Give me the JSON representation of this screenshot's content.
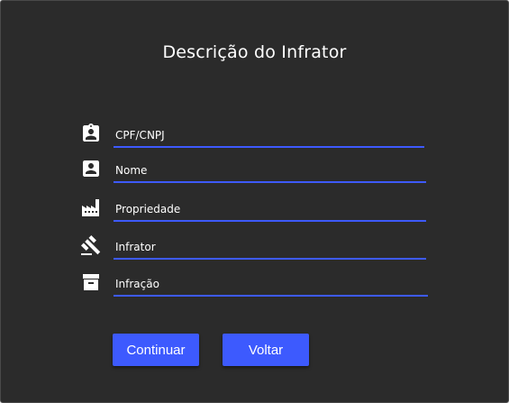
{
  "dialog": {
    "title": "Descrição do Infrator"
  },
  "fields": [
    {
      "icon": "badge-icon",
      "placeholder": "CPF/CNPJ",
      "value": ""
    },
    {
      "icon": "account-box-icon",
      "placeholder": "Nome",
      "value": ""
    },
    {
      "icon": "factory-icon",
      "placeholder": "Propriedade",
      "value": ""
    },
    {
      "icon": "gavel-icon",
      "placeholder": "Infrator",
      "value": ""
    },
    {
      "icon": "archive-icon",
      "placeholder": "Infração",
      "value": ""
    }
  ],
  "buttons": {
    "continue_label": "Continuar",
    "back_label": "Voltar"
  },
  "colors": {
    "background": "#2b2b2b",
    "accent": "#3d5afe",
    "text": "#ffffff"
  }
}
